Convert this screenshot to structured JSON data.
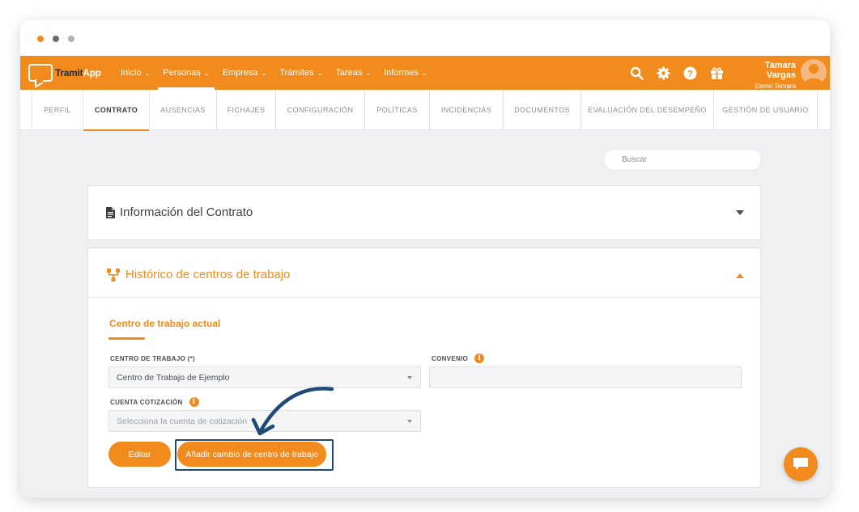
{
  "window": {
    "traffic_lights": [
      "close",
      "minimize",
      "maximize"
    ]
  },
  "brand": {
    "part1": "Tramit",
    "part2": "App",
    "accent": "#f28b1d"
  },
  "nav": {
    "items": [
      {
        "label": "Inicio",
        "active": false
      },
      {
        "label": "Personas",
        "active": true
      },
      {
        "label": "Empresa",
        "active": false
      },
      {
        "label": "Trámites",
        "active": false
      },
      {
        "label": "Tareas",
        "active": false
      },
      {
        "label": "Informes",
        "active": false
      }
    ],
    "icons": [
      "search-icon",
      "gear-icon",
      "help-icon",
      "gift-icon"
    ]
  },
  "user": {
    "name": "Tamara Vargas",
    "company": "Demo Tamara"
  },
  "tabs": [
    {
      "label": "PERFIL",
      "active": false
    },
    {
      "label": "CONTRATO",
      "active": true
    },
    {
      "label": "AUSENCIAS",
      "active": false
    },
    {
      "label": "FICHAJES",
      "active": false
    },
    {
      "label": "CONFIGURACIÓN",
      "active": false
    },
    {
      "label": "POLÍTICAS",
      "active": false
    },
    {
      "label": "INCIDENCIAS",
      "active": false
    },
    {
      "label": "DOCUMENTOS",
      "active": false
    },
    {
      "label": "EVALUACIÓN DEL DESEMPEÑO",
      "active": false
    },
    {
      "label": "GESTIÓN DE USUARIO",
      "active": false
    }
  ],
  "search": {
    "placeholder": "Buscar"
  },
  "panels": {
    "contract_info": {
      "title": "Información del Contrato",
      "expanded": false
    },
    "workplace_history": {
      "title": "Histórico de centros de trabajo",
      "expanded": true,
      "section_title": "Centro de trabajo actual",
      "fields": {
        "workplace": {
          "label": "CENTRO DE TRABAJO (*)",
          "value": "Centro de Trabajo de Ejemplo"
        },
        "agreement": {
          "label": "CONVENIO",
          "value": ""
        },
        "contribution_account": {
          "label": "CUENTA COTIZACIÓN",
          "placeholder": "Selecciona la cuenta de cotización"
        }
      },
      "buttons": {
        "edit": "Editar",
        "add_change": "Añadir cambio de centro de trabajo"
      }
    }
  },
  "annotation": {
    "color": "#1e4a74"
  }
}
